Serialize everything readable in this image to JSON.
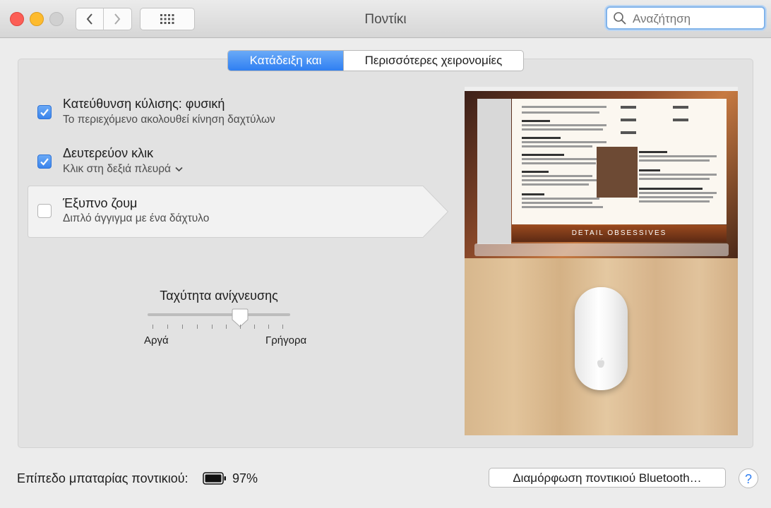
{
  "window": {
    "title": "Ποντίκι",
    "search_placeholder": "Αναζήτηση"
  },
  "toolbar": {
    "back_icon": "chevron-left-icon",
    "forward_icon": "chevron-right-icon",
    "grid_icon": "grid-icon"
  },
  "tabs": [
    {
      "label": "Κατάδειξη και κλικ",
      "active": true
    },
    {
      "label": "Περισσότερες χειρονομίες",
      "active": false
    }
  ],
  "options": [
    {
      "title": "Κατεύθυνση κύλισης: φυσική",
      "subtitle": "Το περιεχόμενο ακολουθεί κίνηση δαχτύλων",
      "checked": true
    },
    {
      "title": "Δευτερεύον κλικ",
      "subtitle": "Κλικ στη δεξιά πλευρά",
      "checked": true
    },
    {
      "title": "Έξυπνο ζουμ",
      "subtitle": "Διπλό άγγιγμα με ένα δάχτυλο",
      "checked": false
    }
  ],
  "tracking": {
    "label": "Ταχύτητα ανίχνευσης",
    "min_label": "Αργά",
    "max_label": "Γρήγορα",
    "value_fraction": 0.6
  },
  "preview": {
    "banner_text": "DETAIL OBSESSIVES"
  },
  "footer": {
    "battery_label": "Επίπεδο μπαταρίας ποντικιού:",
    "battery_percent": "97%",
    "bluetooth_button": "Διαμόρφωση ποντικιού Bluetooth…",
    "help_label": "?"
  },
  "colors": {
    "accent": "#3b84ec",
    "close": "#fc5e56",
    "minimize": "#fdbb2e"
  }
}
